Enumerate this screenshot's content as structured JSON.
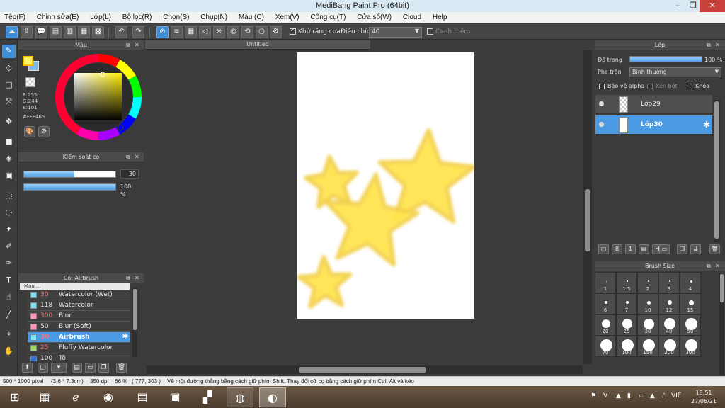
{
  "window": {
    "title": "MediBang Paint Pro (64bit)",
    "controls": [
      "–",
      "❐",
      "✕"
    ]
  },
  "menu": [
    "Tệp(F)",
    "Chỉnh sửa(E)",
    "Lớp(L)",
    "Bộ lọc(R)",
    "Chọn(S)",
    "Chụp(N)",
    "Màu (C)",
    "Xem(V)",
    "Công cụ(T)",
    "Cửa số(W)",
    "Cloud",
    "Help"
  ],
  "toolbar": {
    "antialias_label": "Khử răng cưa",
    "antialias_checked": true,
    "adjust_label": "Điều chỉnh",
    "adjust_value": "40",
    "smooth_label": "Canh mềm",
    "smooth_checked": false
  },
  "color_panel": {
    "title": "Màu",
    "fg_color": "#FFF465",
    "bg_color": "#7AB7E8",
    "r": "R:255",
    "g": "G:244",
    "b": "B:101",
    "hex": "#FFF465"
  },
  "brush_control": {
    "title": "Kiểm soát cọ",
    "size_value": "30",
    "size_fraction": 0.55,
    "opacity_value": "100 %",
    "opacity_fraction": 1.0
  },
  "brush_panel": {
    "title": "Cọ: Airbrush",
    "group_label": "Mau ...",
    "items": [
      {
        "size": "30",
        "name": "Watercolor (Wet)",
        "color": "#7fe0f0",
        "size_color": "red"
      },
      {
        "size": "118",
        "name": "Watercolor",
        "color": "#7fe0f0",
        "size_color": "white"
      },
      {
        "size": "300",
        "name": "Blur",
        "color": "#ff9ab8",
        "size_color": "red"
      },
      {
        "size": "50",
        "name": "Blur (Soft)",
        "color": "#ff9ab8",
        "size_color": "white"
      },
      {
        "size": "30",
        "name": "Airbrush",
        "color": "#7fe0f0",
        "size_color": "red",
        "active": true
      },
      {
        "size": "25",
        "name": "Fluffy Watercolor",
        "color": "#9ee06a",
        "size_color": "red"
      },
      {
        "size": "100",
        "name": "Tô",
        "color": "#3a70d0",
        "size_color": "white"
      }
    ]
  },
  "canvas": {
    "tab_title": "Untitled",
    "star_color": "#FFE44A",
    "star_outline": "#F2D04A"
  },
  "layer_panel": {
    "title": "Lớp",
    "opacity_label": "Độ trong",
    "opacity_value": "100 %",
    "blend_label": "Pha trộn",
    "blend_value": "Bình thường",
    "alpha_protect": "Bảo vệ alpha",
    "clipping": "Xén bớt",
    "lock": "Khóa",
    "layers": [
      {
        "name": "Lớp29",
        "active": false
      },
      {
        "name": "Lớp30",
        "active": true
      }
    ]
  },
  "brush_size_panel": {
    "title": "Brush Size",
    "sizes": [
      "1",
      "1.5",
      "2",
      "3",
      "4",
      "6",
      "7",
      "10",
      "12",
      "15",
      "20",
      "25",
      "30",
      "40",
      "50",
      "70",
      "100",
      "150",
      "200",
      "300"
    ]
  },
  "status": {
    "size": "500 * 1000 pixel",
    "physical": "(3.6 * 7.3cm)",
    "dpi": "350 dpi",
    "zoom": "66 %",
    "coords": "( 777, 303 )",
    "hint": "Vẽ một đường thẳng bằng cách giữ phím Shift, Thay đổi cỡ cọ bằng cách giữ phím Ctrl, Alt và kéo"
  },
  "taskbar": {
    "language": "VIE",
    "time": "18:51",
    "date": "27/06/21"
  }
}
